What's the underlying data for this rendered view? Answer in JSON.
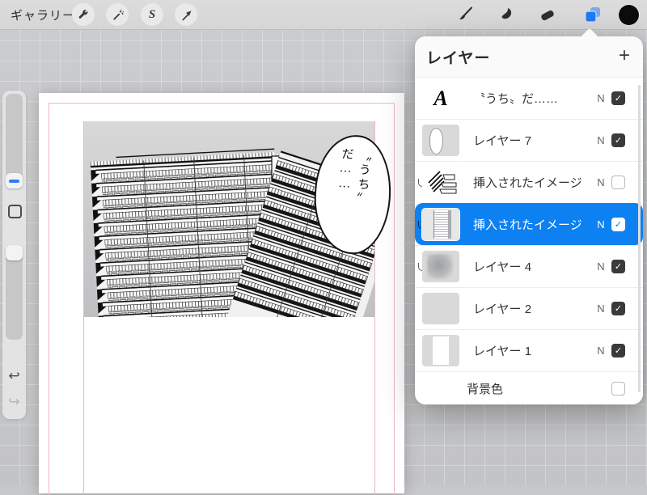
{
  "topbar": {
    "gallery_label": "ギャラリー",
    "left_tools": [
      "wrench",
      "magic-wand",
      "selection",
      "transform-arrow"
    ],
    "right_tools": [
      "paint-brush",
      "smudge",
      "eraser",
      "layers",
      "color-swatch"
    ],
    "selection_glyph": "S"
  },
  "sidebar": {
    "undo_glyph": "↩",
    "redo_glyph": "↪"
  },
  "canvas": {
    "bubble_line1": "〝うち〟",
    "bubble_line2": "だ……"
  },
  "layers_panel": {
    "title": "レイヤー",
    "add_button": "+",
    "rows": [
      {
        "name": "〝うち〟だ……",
        "blend": "N",
        "checked": true,
        "clipped": false,
        "selected": false,
        "thumb_label": "A"
      },
      {
        "name": "レイヤー 7",
        "blend": "N",
        "checked": true,
        "clipped": false,
        "selected": false
      },
      {
        "name": "挿入されたイメージ",
        "blend": "N",
        "checked": false,
        "clipped": true,
        "selected": false
      },
      {
        "name": "挿入されたイメージ",
        "blend": "N",
        "checked": true,
        "clipped": true,
        "selected": true
      },
      {
        "name": "レイヤー 4",
        "blend": "N",
        "checked": true,
        "clipped": true,
        "selected": false
      },
      {
        "name": "レイヤー 2",
        "blend": "N",
        "checked": true,
        "clipped": false,
        "selected": false
      },
      {
        "name": "レイヤー 1",
        "blend": "N",
        "checked": true,
        "clipped": false,
        "selected": false
      }
    ],
    "background_row": {
      "label": "背景色",
      "checked": false
    }
  },
  "colors": {
    "accent_blue": "#0d80f2",
    "layers_icon_blue": "#1e7bf5",
    "swatch_color": "#0c0c0c",
    "guide_pink": "#f0b6c4"
  },
  "check_glyph": "✓"
}
